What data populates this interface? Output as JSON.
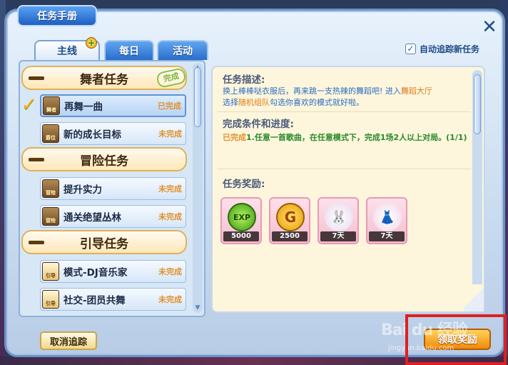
{
  "window": {
    "title": "任务手册",
    "close_symbol": "✕"
  },
  "auto_track": {
    "checked": true,
    "label": "自动追踪新任务"
  },
  "tabs": [
    {
      "label": "主线",
      "active": true
    },
    {
      "label": "每日",
      "active": false
    },
    {
      "label": "活动",
      "active": false
    }
  ],
  "categories": [
    {
      "name": "舞者任务",
      "badge": "完成"
    },
    {
      "name": "冒险任务"
    },
    {
      "name": "引导任务"
    }
  ],
  "tasks": [
    {
      "label": "再舞一曲",
      "icon_text": "舞者",
      "status": "已完成",
      "selected": true
    },
    {
      "label": "新的成长目标",
      "icon_text": "爵位",
      "status": "未完成"
    },
    {
      "label": "提升实力",
      "icon_text": "冒险",
      "status": "未完成"
    },
    {
      "label": "通关绝望丛林",
      "icon_text": "冒险",
      "status": "未完成"
    },
    {
      "label": "模式-DJ音乐家",
      "icon_text": "引导",
      "status": "未完成"
    },
    {
      "label": "社交-团员共舞",
      "icon_text": "引导",
      "status": "未完成"
    }
  ],
  "detail": {
    "desc_title": "任务描述:",
    "desc_part1": "换上棒棒哒衣服后，再来跳一支热辣的舞蹈吧! 进入",
    "desc_hl1": "舞蹈大厅",
    "desc_part2": "选择",
    "desc_hl2": "随机组队",
    "desc_part3": "勾选你喜欢的模式就好啦。",
    "cond_title": "完成条件和进度:",
    "cond_tag": "已完成",
    "cond_text": "1.任意一首歌曲，在任意模式下，完成1场2人以上对局。(1/1)",
    "reward_title": "任务奖励:"
  },
  "rewards": [
    {
      "name": "exp",
      "art": "EXP",
      "count": "5000"
    },
    {
      "name": "gold",
      "art": "G",
      "count": "2500"
    },
    {
      "name": "bunny-hat",
      "art": "🐰",
      "count": "7天"
    },
    {
      "name": "outfit",
      "art": "👗",
      "count": "7天"
    }
  ],
  "buttons": {
    "cancel_label": "取消追踪",
    "claim_label": "领取奖励"
  },
  "watermark": {
    "main": "Bai du 经验",
    "sub": "jingyan.baidu.com"
  },
  "colors": {
    "accent_blue": "#1d5fc4",
    "highlight_red": "#e02020",
    "complete_green": "#7bb53a",
    "status_orange": "#e0922a"
  }
}
